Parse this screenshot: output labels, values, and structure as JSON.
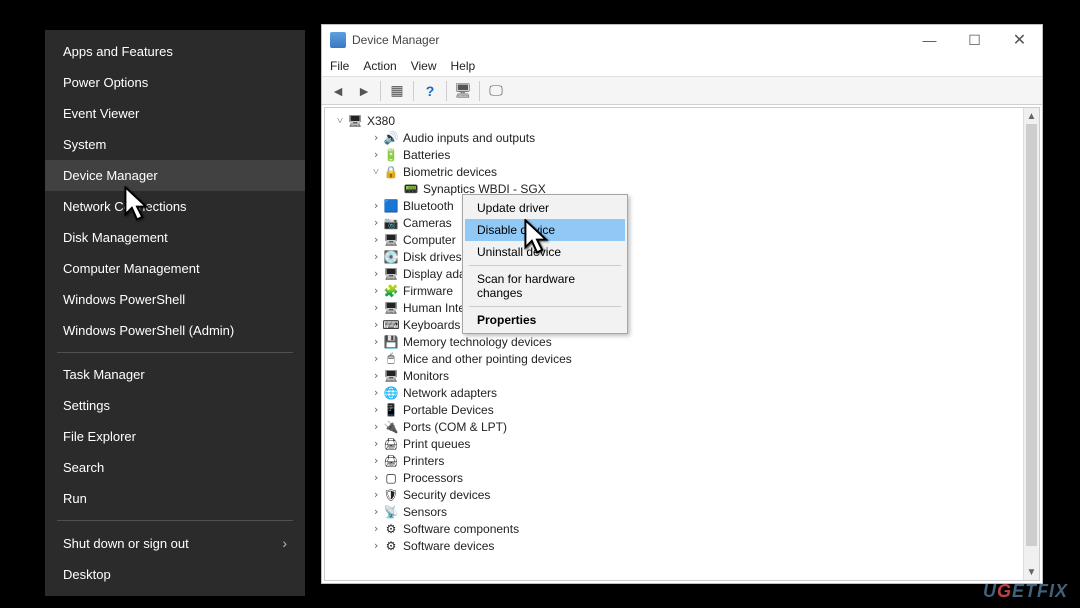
{
  "power_menu": {
    "items_top": [
      "Apps and Features",
      "Power Options",
      "Event Viewer",
      "System",
      "Device Manager",
      "Network Connections",
      "Disk Management",
      "Computer Management",
      "Windows PowerShell",
      "Windows PowerShell (Admin)"
    ],
    "items_mid": [
      "Task Manager",
      "Settings",
      "File Explorer",
      "Search",
      "Run"
    ],
    "items_bot": [
      "Shut down or sign out",
      "Desktop"
    ],
    "highlight_index": 4
  },
  "dm": {
    "title": "Device Manager",
    "menus": [
      "File",
      "Action",
      "View",
      "Help"
    ],
    "root": "X380",
    "categories": [
      {
        "exp": ">",
        "icon": "🔊",
        "label": "Audio inputs and outputs"
      },
      {
        "exp": ">",
        "icon": "🔋",
        "label": "Batteries"
      },
      {
        "exp": "v",
        "icon": "🔒",
        "label": "Biometric devices",
        "children": [
          {
            "icon": "📟",
            "label": "Synaptics WBDI - SGX"
          }
        ]
      },
      {
        "exp": ">",
        "icon": "🟦",
        "label": "Bluetooth"
      },
      {
        "exp": ">",
        "icon": "📷",
        "label": "Cameras"
      },
      {
        "exp": ">",
        "icon": "🖥",
        "label": "Computer"
      },
      {
        "exp": ">",
        "icon": "💽",
        "label": "Disk drives"
      },
      {
        "exp": ">",
        "icon": "🖥",
        "label": "Display adapters"
      },
      {
        "exp": ">",
        "icon": "🧩",
        "label": "Firmware"
      },
      {
        "exp": ">",
        "icon": "🖥",
        "label": "Human Interface Devices"
      },
      {
        "exp": ">",
        "icon": "⌨",
        "label": "Keyboards"
      },
      {
        "exp": ">",
        "icon": "💾",
        "label": "Memory technology devices"
      },
      {
        "exp": ">",
        "icon": "🖱",
        "label": "Mice and other pointing devices"
      },
      {
        "exp": ">",
        "icon": "🖥",
        "label": "Monitors"
      },
      {
        "exp": ">",
        "icon": "🌐",
        "label": "Network adapters"
      },
      {
        "exp": ">",
        "icon": "📱",
        "label": "Portable Devices"
      },
      {
        "exp": ">",
        "icon": "🔌",
        "label": "Ports (COM & LPT)"
      },
      {
        "exp": ">",
        "icon": "🖨",
        "label": "Print queues"
      },
      {
        "exp": ">",
        "icon": "🖨",
        "label": "Printers"
      },
      {
        "exp": ">",
        "icon": "▢",
        "label": "Processors"
      },
      {
        "exp": ">",
        "icon": "🛡",
        "label": "Security devices"
      },
      {
        "exp": ">",
        "icon": "📡",
        "label": "Sensors"
      },
      {
        "exp": ">",
        "icon": "⚙",
        "label": "Software components"
      },
      {
        "exp": ">",
        "icon": "⚙",
        "label": "Software devices"
      }
    ]
  },
  "context_menu": {
    "items": [
      {
        "label": "Update driver"
      },
      {
        "label": "Disable device",
        "highlight": true
      },
      {
        "label": "Uninstall device"
      },
      {
        "sep": true
      },
      {
        "label": "Scan for hardware changes"
      },
      {
        "sep": true
      },
      {
        "label": "Properties",
        "bold": true
      }
    ]
  },
  "watermark": "UGETFIX"
}
